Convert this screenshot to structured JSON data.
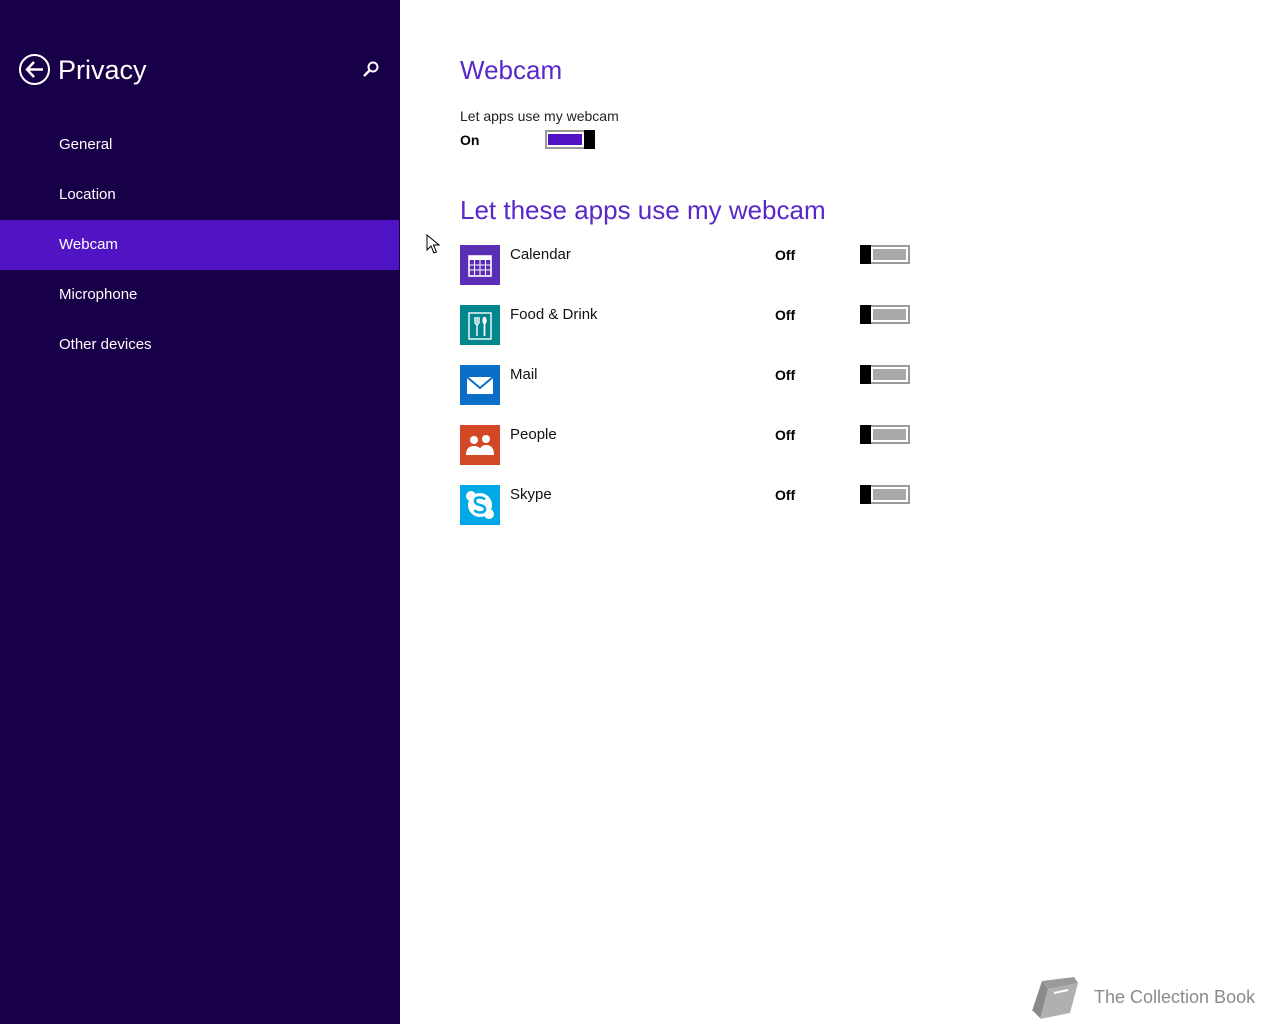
{
  "sidebar": {
    "title": "Privacy",
    "items": [
      {
        "label": "General"
      },
      {
        "label": "Location"
      },
      {
        "label": "Webcam"
      },
      {
        "label": "Microphone"
      },
      {
        "label": "Other devices"
      }
    ],
    "selected": "Webcam"
  },
  "main": {
    "title": "Webcam",
    "master_toggle": {
      "label": "Let apps use my webcam",
      "state": "On"
    },
    "apps_heading": "Let these apps use my webcam",
    "apps": [
      {
        "name": "Calendar",
        "state": "Off",
        "icon": "calendar-icon",
        "tile_color": "#5b2fb5"
      },
      {
        "name": "Food & Drink",
        "state": "Off",
        "icon": "fork-knife-icon",
        "tile_color": "#00868c"
      },
      {
        "name": "Mail",
        "state": "Off",
        "icon": "envelope-icon",
        "tile_color": "#0a6ec6"
      },
      {
        "name": "People",
        "state": "Off",
        "icon": "people-icon",
        "tile_color": "#d24726"
      },
      {
        "name": "Skype",
        "state": "Off",
        "icon": "skype-icon",
        "tile_color": "#00a9e6"
      }
    ]
  },
  "watermark": {
    "text": "The Collection Book"
  },
  "colors": {
    "sidebar_bg": "#180048",
    "selected_bg": "#5014c4",
    "accent": "#5a28c8"
  }
}
